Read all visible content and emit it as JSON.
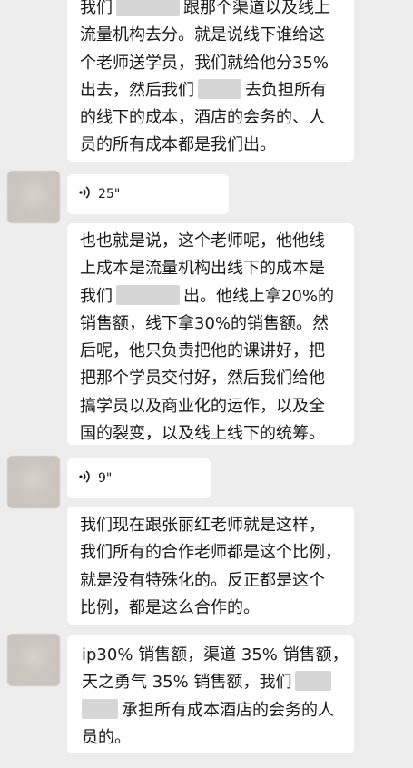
{
  "messages": [
    {
      "type": "text",
      "lines": [
        {
          "pre": "我们",
          "blur": true,
          "post": "跟那个渠道以及线上"
        },
        {
          "text": "流量机构去分。就是说线下谁给这"
        },
        {
          "text": "个老师送学员，我们就给他分35%"
        },
        {
          "pre": "出去，然后我们",
          "blur": true,
          "post": "去负担所有"
        },
        {
          "text": "的线下的成本，酒店的会务的、人"
        },
        {
          "text": "员的所有成本都是我们出。"
        }
      ]
    },
    {
      "type": "voice",
      "duration": "25\""
    },
    {
      "type": "text",
      "lines": [
        {
          "text": "也也就是说，这个老师呢，他他线"
        },
        {
          "text": "上成本是流量机构出线下的成本是"
        },
        {
          "pre": "我们",
          "blur": true,
          "post": "出。他线上拿20%的"
        },
        {
          "text": "销售额，线下拿30%的销售额。然"
        },
        {
          "text": "后呢，他只负责把他的课讲好，把"
        },
        {
          "text": "把那个学员交付好，然后我们给他"
        },
        {
          "text": "搞学员以及商业化的运作，以及全"
        },
        {
          "text": "国的裂变，以及线上线下的统筹。"
        }
      ]
    },
    {
      "type": "voice",
      "duration": "9\""
    },
    {
      "type": "text",
      "lines": [
        {
          "text": "我们现在跟张丽红老师就是这样，"
        },
        {
          "text": "我们所有的合作老师都是这个比例，"
        },
        {
          "text": "就是没有特殊化的。反正都是这个"
        },
        {
          "text": "比例，都是这么合作的。"
        }
      ]
    },
    {
      "type": "text",
      "lines": [
        {
          "text": "ip30% 销售额，渠道 35% 销售额，"
        },
        {
          "pre": "天之勇气 35% 销售额，我们",
          "blur": true,
          "post": ""
        },
        {
          "pre": "",
          "blur": true,
          "post": "承担所有成本酒店的会务的人"
        },
        {
          "text": "员的。"
        }
      ]
    }
  ],
  "icons": {
    "voice": "voice-wave-icon",
    "avatar": "blurred-avatar"
  },
  "colors": {
    "background": "#ededed",
    "bubble": "#ffffff",
    "text": "#1a1a1a",
    "redaction": "#d6d6d6"
  }
}
